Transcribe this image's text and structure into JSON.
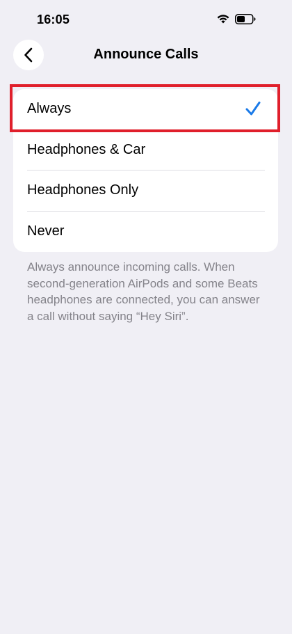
{
  "status_bar": {
    "time": "16:05",
    "wifi_icon": "wifi-icon",
    "battery_icon": "battery-icon"
  },
  "nav": {
    "back_icon": "chevron-left-icon",
    "title": "Announce Calls"
  },
  "options": [
    {
      "label": "Always",
      "selected": true
    },
    {
      "label": "Headphones & Car",
      "selected": false
    },
    {
      "label": "Headphones Only",
      "selected": false
    },
    {
      "label": "Never",
      "selected": false
    }
  ],
  "footer_note": "Always announce incoming calls. When second-generation AirPods and some Beats headphones are connected, you can answer a call without saying “Hey Siri”.",
  "colors": {
    "background": "#f0eff5",
    "accent": "#1a7ae8",
    "highlight": "#e01f2b",
    "secondary_text": "#84838a"
  }
}
